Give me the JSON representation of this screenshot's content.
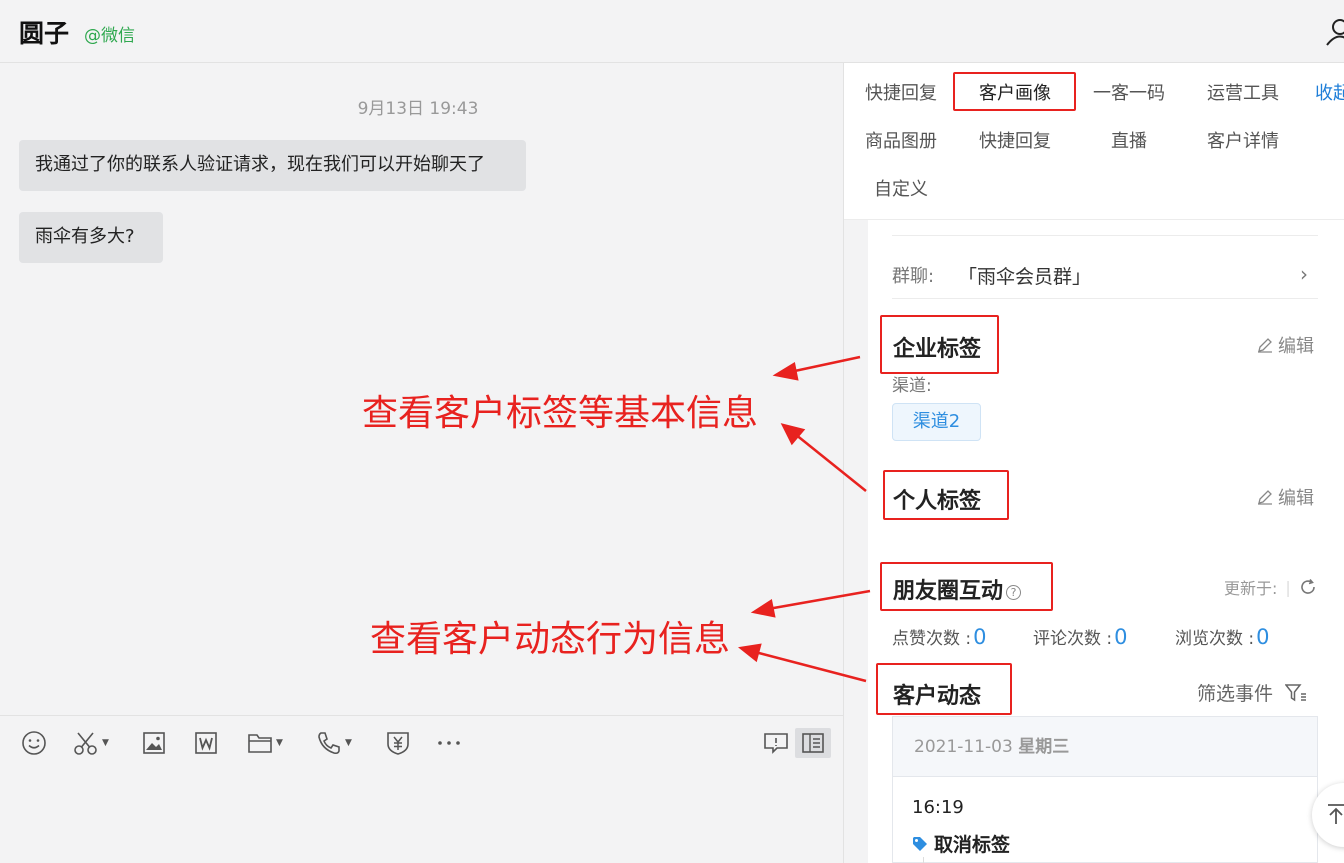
{
  "header": {
    "title": "圆子",
    "source": "@微信"
  },
  "chat": {
    "timestamp": "9月13日 19:43",
    "messages": [
      "我通过了你的联系人验证请求，现在我们可以开始聊天了",
      "雨伞有多大?"
    ]
  },
  "annotations": {
    "basic_info": "查看客户标签等基本信息",
    "dynamic_info": "查看客户动态行为信息"
  },
  "tabs": {
    "row1": [
      "快捷回复",
      "客户画像",
      "一客一码",
      "运营工具",
      "收起"
    ],
    "row2": [
      "商品图册",
      "快捷回复",
      "直播",
      "客户详情"
    ],
    "row3": [
      "自定义"
    ],
    "active": "客户画像"
  },
  "profile": {
    "group_label": "群聊:",
    "group_name": "「雨伞会员群」",
    "corp_tags_title": "企业标签",
    "edit_label": "编辑",
    "channel_label": "渠道:",
    "channel_tag": "渠道2",
    "personal_tags_title": "个人标签",
    "moments_title": "朋友圈互动",
    "updated_label": "更新于:",
    "stats": [
      {
        "label": "点赞次数 :",
        "value": "0"
      },
      {
        "label": "评论次数 :",
        "value": "0"
      },
      {
        "label": "浏览次数 :",
        "value": "0"
      }
    ],
    "activity_title": "客户动态",
    "filter_label": "筛选事件",
    "timeline": {
      "date": "2021-11-03",
      "weekday": "星期三",
      "time": "16:19",
      "event": "取消标签"
    }
  },
  "colors": {
    "accent": "#e8221f",
    "link": "#1e7ed8",
    "wechat_green": "#2fa84f"
  },
  "toolbar_icons": [
    "emoji-icon",
    "scissors-icon",
    "image-icon",
    "word-icon",
    "folder-icon",
    "phone-icon",
    "yuan-icon",
    "more-icon",
    "comment-icon",
    "sidebar-icon"
  ]
}
